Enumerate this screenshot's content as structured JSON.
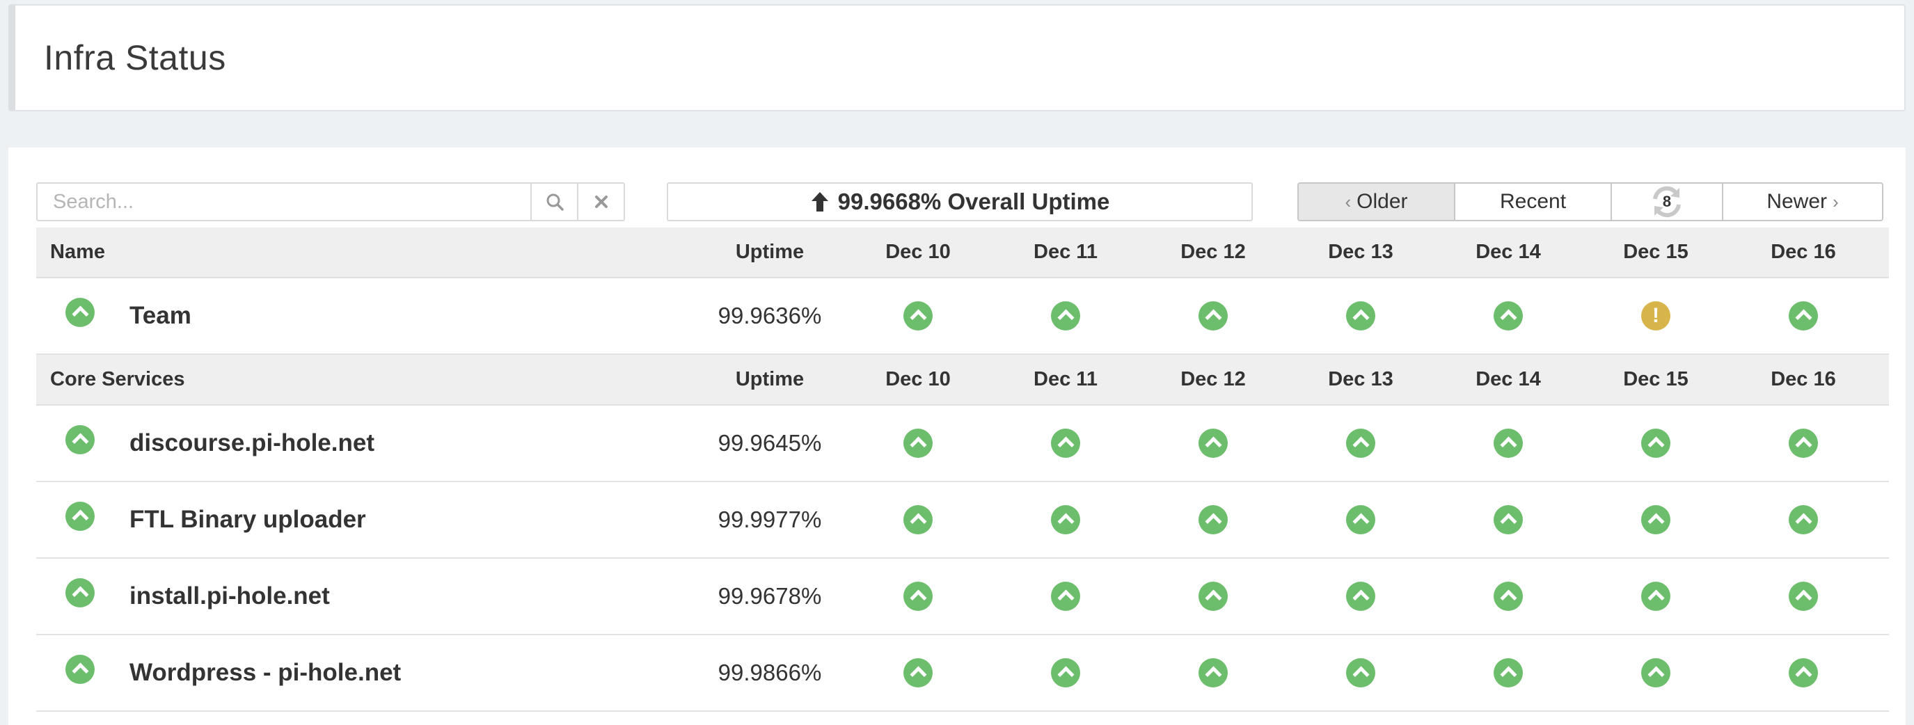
{
  "header": {
    "title": "Infra Status"
  },
  "toolbar": {
    "search_placeholder": "Search...",
    "overall_uptime": "99.9668% Overall Uptime",
    "nav": {
      "older": "Older",
      "recent": "Recent",
      "refresh_count": "8",
      "newer": "Newer"
    }
  },
  "groups": [
    {
      "header": {
        "name": "Name",
        "uptime": "Uptime",
        "days": [
          "Dec 10",
          "Dec 11",
          "Dec 12",
          "Dec 13",
          "Dec 14",
          "Dec 15",
          "Dec 16"
        ]
      },
      "rows": [
        {
          "name": "Team",
          "uptime": "99.9636%",
          "status": "up",
          "days": [
            "up",
            "up",
            "up",
            "up",
            "up",
            "warn",
            "up"
          ]
        }
      ]
    },
    {
      "header": {
        "name": "Core Services",
        "uptime": "Uptime",
        "days": [
          "Dec 10",
          "Dec 11",
          "Dec 12",
          "Dec 13",
          "Dec 14",
          "Dec 15",
          "Dec 16"
        ]
      },
      "rows": [
        {
          "name": "discourse.pi-hole.net",
          "uptime": "99.9645%",
          "status": "up",
          "days": [
            "up",
            "up",
            "up",
            "up",
            "up",
            "up",
            "up"
          ]
        },
        {
          "name": "FTL Binary uploader",
          "uptime": "99.9977%",
          "status": "up",
          "days": [
            "up",
            "up",
            "up",
            "up",
            "up",
            "up",
            "up"
          ]
        },
        {
          "name": "install.pi-hole.net",
          "uptime": "99.9678%",
          "status": "up",
          "days": [
            "up",
            "up",
            "up",
            "up",
            "up",
            "up",
            "up"
          ]
        },
        {
          "name": "Wordpress - pi-hole.net",
          "uptime": "99.9866%",
          "status": "up",
          "days": [
            "up",
            "up",
            "up",
            "up",
            "up",
            "up",
            "up"
          ]
        }
      ]
    }
  ],
  "colors": {
    "up": "#6cbd6c",
    "warn": "#d7b54a",
    "header_bg": "#efefef"
  },
  "icons": {
    "up": "chevron-up-circle-icon",
    "warn": "exclamation-circle-icon"
  }
}
